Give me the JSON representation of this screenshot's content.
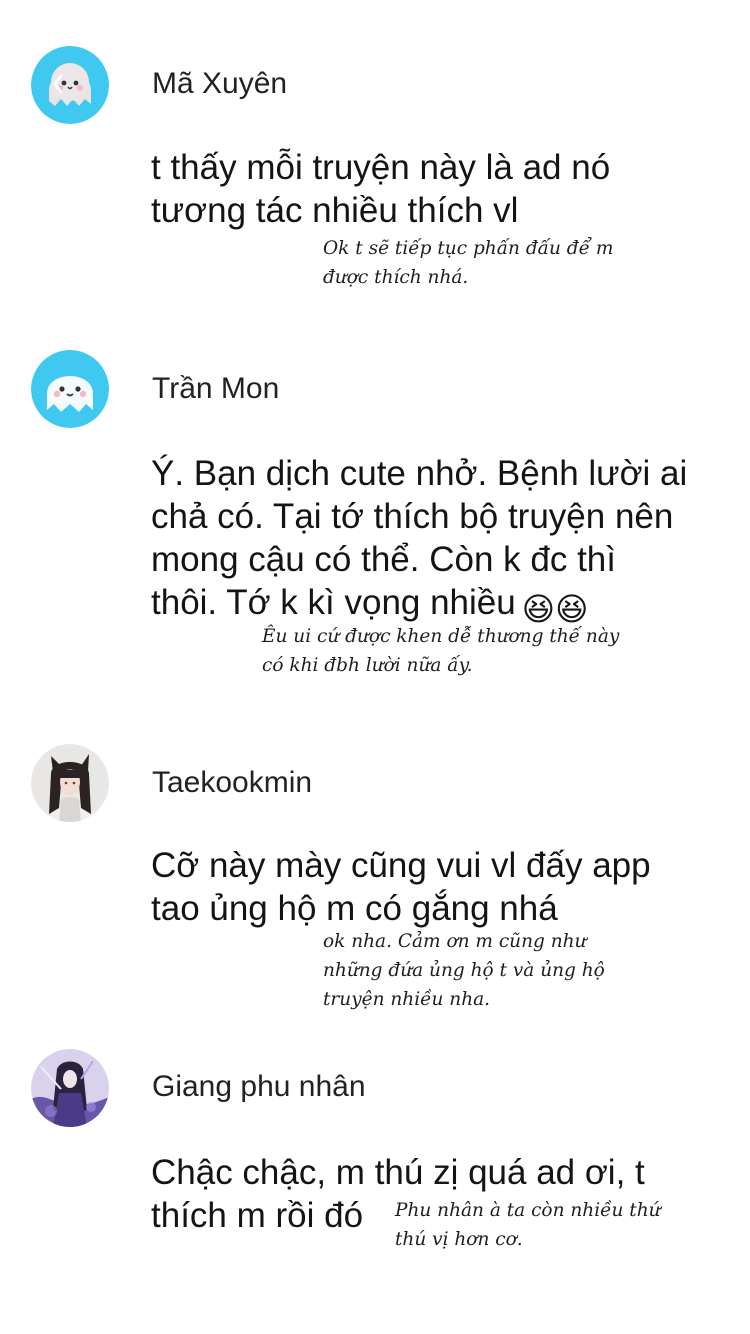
{
  "comments": [
    {
      "username": "Mã Xuyên",
      "text": "t thấy mỗi truyện này là ad nó tương tác nhiều thích vl",
      "reply_lines": [
        "Ok t sẽ tiếp tục phấn đấu để m",
        "được thích nhá."
      ],
      "avatar_icon": "ghost-mascot-back-arrow-icon"
    },
    {
      "username": "Trần Mon",
      "text_lines": [
        "Ý. Bạn dịch cute nhở. Bệnh lười ai",
        "chả có. Tại tớ thích bộ truyện nên",
        "mong cậu có thể. Còn k đc thì",
        "thôi. Tớ k kì vọng nhiều"
      ],
      "emoji": "😆😆",
      "reply_lines": [
        "Êu ui cứ được khen dễ thương thế này",
        "có khi đbh lười nữa ấy."
      ],
      "avatar_icon": "ghost-mascot-icon"
    },
    {
      "username": "Taekookmin",
      "text_lines": [
        "Cỡ này mày cũng vui vl đấy app",
        "tao ủng hộ m có gắng nhá"
      ],
      "reply_lines": [
        "ok nha. Cảm ơn m cũng như",
        "những đứa ủng hộ t và ủng hộ",
        "truyện nhiều nha."
      ],
      "avatar_icon": "anime-cat-girl-avatar-icon"
    },
    {
      "username": "Giang phu nhân",
      "text_lines": [
        "Chậc chậc, m thú zị quá ad ơi, t",
        "thích m rồi đó"
      ],
      "reply_lines": [
        "Phu nhân à ta còn nhiều thứ",
        "thú vị hơn cơ."
      ],
      "avatar_icon": "anime-purple-warrior-avatar-icon"
    }
  ],
  "colors": {
    "mascot_bg": "#3fc8f0",
    "mascot_body": "#f4fbff",
    "text": "#141414",
    "background": "#ffffff"
  }
}
